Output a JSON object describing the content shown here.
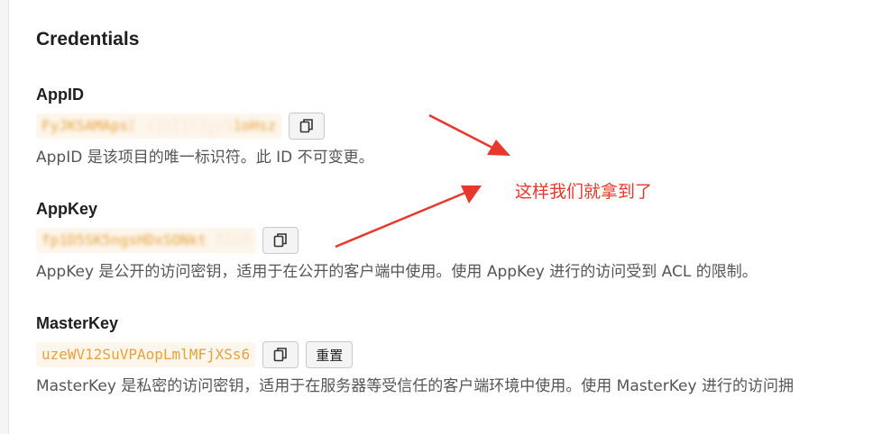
{
  "section_title": "Credentials",
  "credentials": [
    {
      "label": "AppID",
      "value": "FyJKSAMApsI             s1hI1lJgzS1oHsz",
      "description": "AppID 是该项目的唯一标识符。此 ID 不可变更。"
    },
    {
      "label": "AppKey",
      "value": "fp1D5SK5ngsHDxSONkt  ISbM",
      "description": "AppKey 是公开的访问密钥，适用于在公开的客户端中使用。使用 AppKey 进行的访问受到 ACL 的限制。"
    },
    {
      "label": "MasterKey",
      "value": "uzeWV12SuVPAopLmlMFjXSs6",
      "description": "MasterKey 是私密的访问密钥，适用于在服务器等受信任的客户端环境中使用。使用 MasterKey 进行的访问拥"
    }
  ],
  "reset_button_label": "重置",
  "annotation_text": "这样我们就拿到了",
  "icons": {
    "copy": "copy-icon"
  },
  "colors": {
    "value_text": "#e6a23c",
    "value_bg": "#fdf6ec",
    "annotation": "#e8372c"
  }
}
